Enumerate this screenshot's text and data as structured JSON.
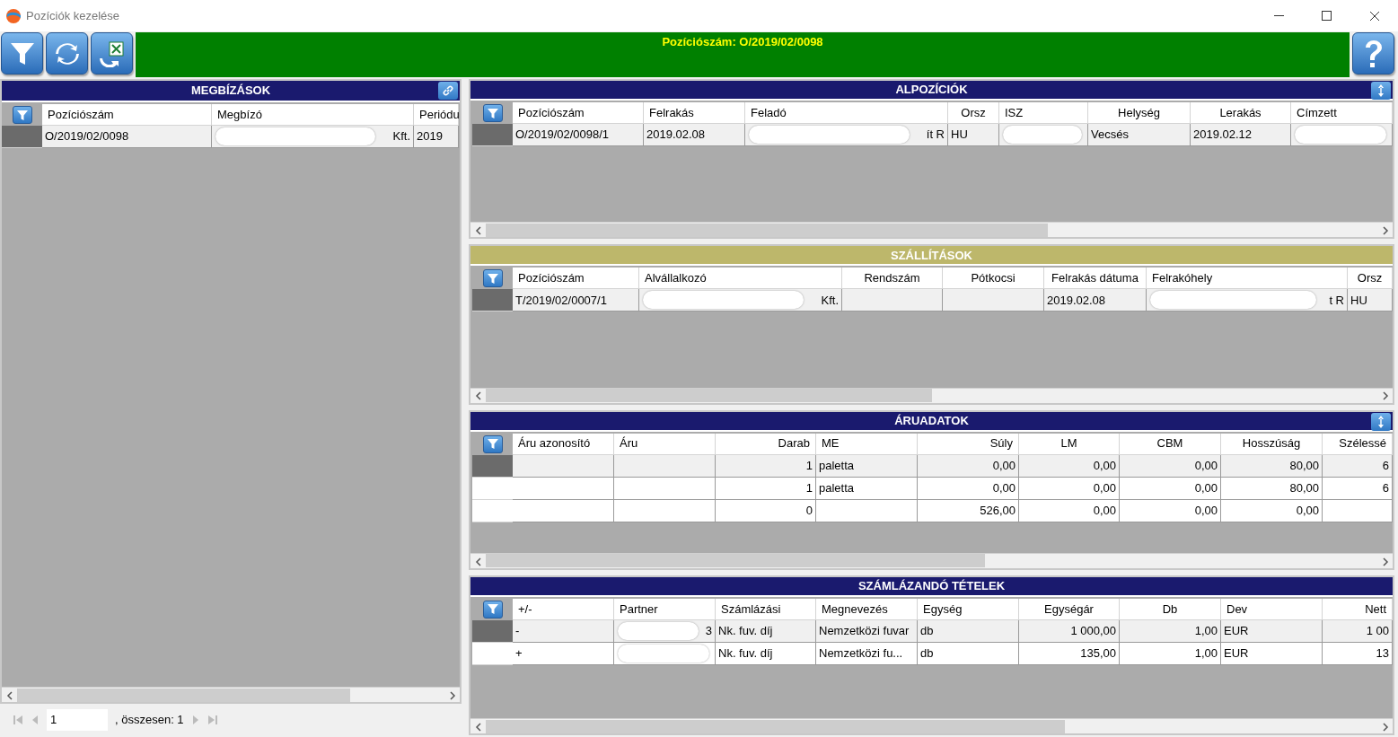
{
  "window": {
    "title": "Pozíciók kezelése"
  },
  "banner": {
    "text": "Pozíciószám: O/2019/02/0098"
  },
  "orders": {
    "title": "MEGBÍZÁSOK",
    "columns": [
      "Pozíciószám",
      "Megbízó",
      "Periódu"
    ],
    "rows": [
      {
        "selected": true,
        "cells": [
          {
            "text": "O/2019/02/0098"
          },
          {
            "text": "Kft.",
            "redacted": true
          },
          {
            "text": "2019"
          }
        ]
      }
    ],
    "pager": {
      "page": "1",
      "total": ", összesen: 1"
    }
  },
  "panels": [
    {
      "title": "ALPOZÍCIÓK",
      "color": "#1a1a6e",
      "columns": [
        "Pozíciószám",
        "Felrakás",
        "Feladó",
        "Orsz",
        "ISZ",
        "Helység",
        "Lerakás",
        "Címzett"
      ],
      "rows": [
        {
          "selected": true,
          "cells": [
            {
              "text": "O/2019/02/0098/1"
            },
            {
              "text": "2019.02.08"
            },
            {
              "text": "ít R",
              "redacted": true
            },
            {
              "text": "HU"
            },
            {
              "redacted": true
            },
            {
              "text": "Vecsés"
            },
            {
              "text": "2019.02.12"
            },
            {
              "redacted": true
            }
          ]
        }
      ]
    },
    {
      "title": "SZÁLLÍTÁSOK",
      "color": "#bdb76b",
      "columns": [
        "Pozíciószám",
        "Alvállalkozó",
        "Rendszám",
        "Pótkocsi",
        "Felrakás dátuma",
        "Felrakóhely",
        "Orsz"
      ],
      "rows": [
        {
          "selected": true,
          "cells": [
            {
              "text": "T/2019/02/0007/1"
            },
            {
              "text": "Kft.",
              "redacted": true
            },
            {},
            {},
            {
              "text": "2019.02.08"
            },
            {
              "text": "t R",
              "redacted": true
            },
            {
              "text": "HU"
            }
          ]
        }
      ]
    },
    {
      "title": "ÁRUADATOK",
      "color": "#1a1a6e",
      "columns": [
        "Áru azonosító",
        "Áru",
        "Darab",
        "ME",
        "Súly",
        "LM",
        "CBM",
        "Hosszúság",
        "Szélessé"
      ],
      "rows": [
        {
          "selected": true,
          "cells": [
            {},
            {},
            {
              "text": "1"
            },
            {
              "text": "paletta"
            },
            {
              "text": "0,00"
            },
            {
              "text": "0,00"
            },
            {
              "text": "0,00"
            },
            {
              "text": "80,00"
            },
            {
              "text": "6"
            }
          ]
        },
        {
          "selected": false,
          "cells": [
            {},
            {},
            {
              "text": "1"
            },
            {
              "text": "paletta"
            },
            {
              "text": "0,00"
            },
            {
              "text": "0,00"
            },
            {
              "text": "0,00"
            },
            {
              "text": "80,00"
            },
            {
              "text": "6"
            }
          ]
        },
        {
          "selected": false,
          "cells": [
            {},
            {},
            {
              "text": "0"
            },
            {},
            {
              "text": "526,00"
            },
            {
              "text": "0,00"
            },
            {
              "text": "0,00"
            },
            {
              "text": "0,00"
            },
            {}
          ]
        }
      ]
    },
    {
      "title": "SZÁMLÁZANDÓ TÉTELEK",
      "color": "#1a1a6e",
      "columns": [
        "+/-",
        "Partner",
        "Számlázási",
        "Megnevezés",
        "Egység",
        "Egységár",
        "Db",
        "Dev",
        "Nett"
      ],
      "rows": [
        {
          "selected": true,
          "cells": [
            {
              "text": "-"
            },
            {
              "text": "3",
              "redacted": true
            },
            {
              "text": "Nk. fuv. díj"
            },
            {
              "text": "Nemzetközi fuvar"
            },
            {
              "text": "db"
            },
            {
              "text": "1 000,00"
            },
            {
              "text": "1,00"
            },
            {
              "text": "EUR"
            },
            {
              "text": "1 00"
            }
          ]
        },
        {
          "selected": false,
          "cells": [
            {
              "text": "+"
            },
            {
              "redacted": true
            },
            {
              "text": "Nk. fuv. díj"
            },
            {
              "text": "Nemzetközi fu..."
            },
            {
              "text": "db"
            },
            {
              "text": "135,00"
            },
            {
              "text": "1,00"
            },
            {
              "text": "EUR"
            },
            {
              "text": "13"
            }
          ]
        }
      ]
    }
  ]
}
